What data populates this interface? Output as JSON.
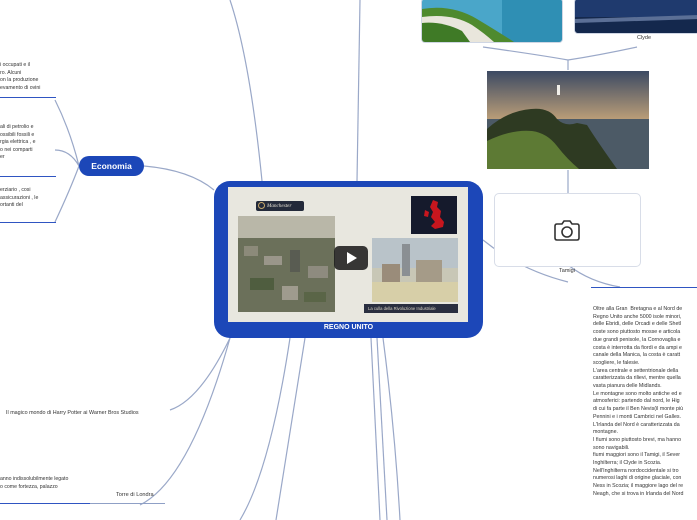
{
  "central": {
    "title": "REGNO UNITO",
    "video_badge": "Manchester",
    "video_caption": "La culla della Rivoluzione Industriale"
  },
  "economia": {
    "label": "Economia",
    "text_1": "i occupati e il\nro. Alcuni\non la produzione\nevamento di ovini",
    "text_2": "ali di petrolio e\nossibili fossili e\nrgia elettrica , e\no nei comparti\ner",
    "text_3": "erziario , cosi\nassicurazioni , le\nortanti del"
  },
  "images": {
    "clyde_caption": "Clyde",
    "tamigi_caption": "Tamigi"
  },
  "left_topics": {
    "harry_potter": "Il magico mondo di Harry Potter ai Warner Bros Studios",
    "torre_text": "anno indissolubilmente legato\no come fortezza, palazzo",
    "torre_label": "Torre di Londra"
  },
  "description": {
    "text": "Oltre alla Gran  Bretagna e al Nord de\nRegno Unito anche 5000 isole minori,\ndelle Ebridi, delle Orcadi e delle Shetl\ncoste sono piuttosto mosse e articola\ndue grandi penisole, la Cornovaglia e\ncosta è interrotta da fiordi e da ampi e\ncanale della Manica, la costa è caratt\nscogliere, le falesie.\nL'area centrale e settentrionale della\ncaratterizzata da rilievi, mentre quella\nvasta pianura delle Midlands.\nLe montagne sono molto antiche ed e\natmosferici: partendo dal nord, le Hig\ndi cui fa parte il Ben Nevis(il monte più\nPennini e i monti Cambrici nel Galles.\nL'Irlanda del Nord è caratterizzata da\nmontagne.\nI fiumi sono piuttosto brevi, ma hanno\nsono navigabili.\nfiumi maggiori sono il Tamigi, il Sever\nInghilterra; il Clyde in Scozia.\nNell'Inghilterra nordoccidentale si tro\nnumerosi laghi di origine glaciale, con\nNess in Scozia; il maggiore lago del re\nNeagh, che si trova in Irlanda del Nord"
  }
}
